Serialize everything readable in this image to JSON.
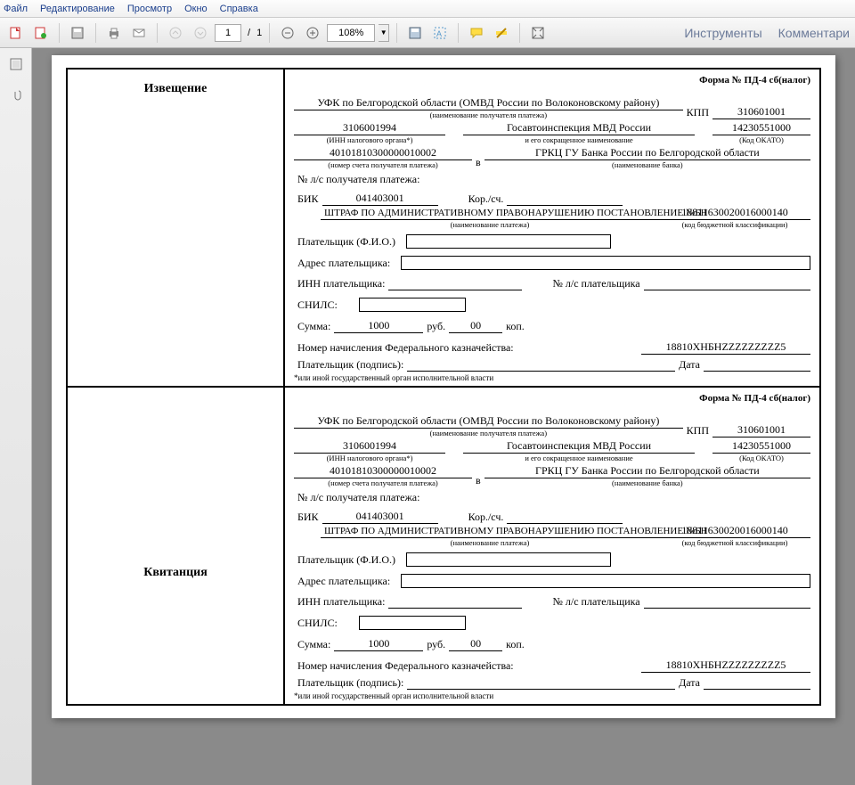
{
  "menu": {
    "file": "Файл",
    "edit": "Редактирование",
    "view": "Просмотр",
    "window": "Окно",
    "help": "Справка"
  },
  "toolbar": {
    "page_current": "1",
    "page_sep": "/",
    "page_total": "1",
    "zoom": "108%",
    "right": {
      "tools": "Инструменты",
      "comments": "Комментари"
    }
  },
  "doc": {
    "form_header": "Форма № ПД-4 сб(налог)",
    "left_top": "Извещение",
    "left_bottom": "Квитанция",
    "recipient": "УФК по Белгородской области (ОМВД России по Волоконовскому району)",
    "recipient_sub": "(наименование получателя платежа)",
    "kpp_lbl": "КПП",
    "kpp_val": "310601001",
    "inn_val": "3106001994",
    "inn_sub": "(ИНН налогового органа*)",
    "gai": "Госавтоинспекция МВД России",
    "gai_sub": "и его сокращенное наименование",
    "okato_val": "14230551000",
    "okato_sub": "(Код ОКАТО)",
    "acct": "40101810300000010002",
    "acct_sub": "(номер счета получателя платежа)",
    "in_lbl": "в",
    "bank": "ГРКЦ ГУ Банка России по Белгородской области",
    "bank_sub": "(наименование банка)",
    "ls_lbl": "№ л/с получателя платежа:",
    "bik_lbl": "БИК",
    "bik_val": "041403001",
    "korr_lbl": "Кор./сч.",
    "pay_name": "ШТРАФ ПО АДМИНИСТРАТИВНОМУ ПРАВОНАРУШЕНИЮ ПОСТАНОВЛЕНИЕ №БН",
    "pay_name_sub": "(наименование платежа)",
    "kbk_val": "18811630020016000140",
    "kbk_sub": "(код бюджетной классификации)",
    "payer_lbl": "Плательщик (Ф.И.О.)",
    "addr_lbl": "Адрес плательщика:",
    "inn_payer_lbl": "ИНН плательщика:",
    "ls_payer_lbl": "№ л/с плательщика",
    "snils_lbl": "СНИЛС:",
    "sum_lbl": "Сумма:",
    "sum_rub": "1000",
    "rub_lbl": "руб.",
    "sum_kop": "00",
    "kop_lbl": "коп.",
    "accrual_lbl": "Номер начисления Федерального казначейства:",
    "accrual_val": "18810ХНБНZZZZZZZZZ5",
    "sign_lbl": "Плательщик (подпись):",
    "date_lbl": "Дата",
    "footnote": "*или иной государственный орган исполнительной власти"
  }
}
